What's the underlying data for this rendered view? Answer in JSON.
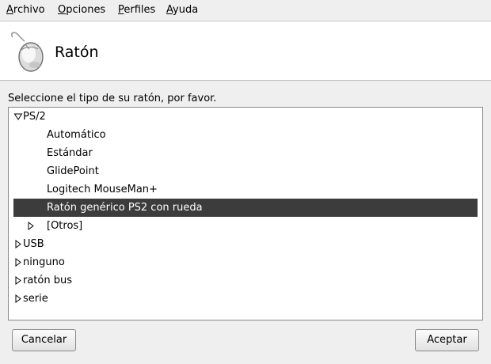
{
  "menu": {
    "items": [
      {
        "label": "Archivo"
      },
      {
        "label": "Opciones"
      },
      {
        "label": "Perfiles"
      },
      {
        "label": "Ayuda"
      }
    ]
  },
  "header": {
    "title": "Ratón",
    "icon": "mouse-icon"
  },
  "instruction": "Seleccione el tipo de su ratón, por favor.",
  "tree": {
    "items": [
      {
        "label": "PS/2",
        "level": 0,
        "expander": "expanded"
      },
      {
        "label": "Automático",
        "level": 1,
        "expander": "none"
      },
      {
        "label": "Estándar",
        "level": 1,
        "expander": "none"
      },
      {
        "label": "GlidePoint",
        "level": 1,
        "expander": "none"
      },
      {
        "label": "Logitech MouseMan+",
        "level": 1,
        "expander": "none"
      },
      {
        "label": "Ratón genérico PS2 con rueda",
        "level": 1,
        "expander": "none",
        "selected": true
      },
      {
        "label": "[Otros]",
        "level": 1,
        "expander": "collapsed"
      },
      {
        "label": "USB",
        "level": 0,
        "expander": "collapsed"
      },
      {
        "label": "ninguno",
        "level": 0,
        "expander": "collapsed"
      },
      {
        "label": "ratón bus",
        "level": 0,
        "expander": "collapsed"
      },
      {
        "label": "serie",
        "level": 0,
        "expander": "collapsed"
      }
    ]
  },
  "buttons": {
    "cancel": "Cancelar",
    "ok": "Aceptar"
  },
  "colors": {
    "selection_bg": "#3c3c3c",
    "selection_fg": "#ffffff",
    "window_bg": "#efefef"
  }
}
